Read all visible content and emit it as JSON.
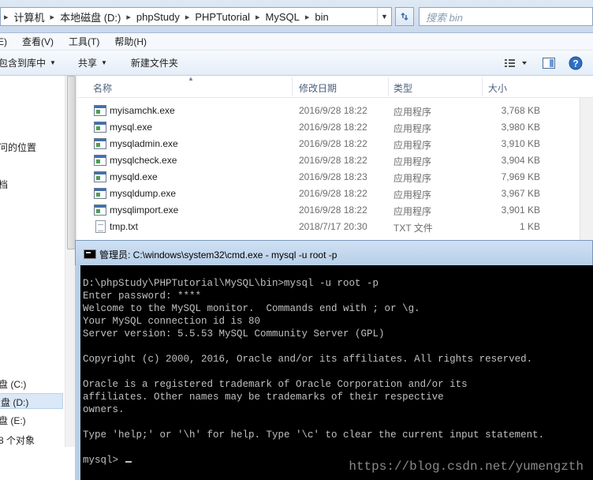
{
  "explorer": {
    "address": {
      "crumbs": [
        "计算机",
        "本地磁盘 (D:)",
        "phpStudy",
        "PHPTutorial",
        "MySQL",
        "bin"
      ],
      "dropdown_icon": "chevron-down-icon",
      "refresh_icon": "refresh-icon"
    },
    "search": {
      "placeholder": "搜索 bin"
    },
    "menu": [
      "E)",
      "查看(V)",
      "工具(T)",
      "帮助(H)"
    ],
    "toolbar": {
      "include_library": "包含到库中",
      "share": "共享",
      "new_folder": "新建文件夹"
    },
    "nav": {
      "recent": "问的位置",
      "docs": "档",
      "drive_c": "盘 (C:)",
      "drive_d": "盘 (D:)",
      "drive_e": "盘 (E:)",
      "count": "8 个对象"
    },
    "columns": {
      "name": "名称",
      "date": "修改日期",
      "type": "类型",
      "size": "大小"
    },
    "files": [
      {
        "name": "myisamchk.exe",
        "date": "2016/9/28 18:22",
        "type": "应用程序",
        "size": "3,768 KB",
        "icon": "exe"
      },
      {
        "name": "mysql.exe",
        "date": "2016/9/28 18:22",
        "type": "应用程序",
        "size": "3,980 KB",
        "icon": "exe"
      },
      {
        "name": "mysqladmin.exe",
        "date": "2016/9/28 18:22",
        "type": "应用程序",
        "size": "3,910 KB",
        "icon": "exe"
      },
      {
        "name": "mysqlcheck.exe",
        "date": "2016/9/28 18:22",
        "type": "应用程序",
        "size": "3,904 KB",
        "icon": "exe"
      },
      {
        "name": "mysqld.exe",
        "date": "2016/9/28 18:23",
        "type": "应用程序",
        "size": "7,969 KB",
        "icon": "exe"
      },
      {
        "name": "mysqldump.exe",
        "date": "2016/9/28 18:22",
        "type": "应用程序",
        "size": "3,967 KB",
        "icon": "exe"
      },
      {
        "name": "mysqlimport.exe",
        "date": "2016/9/28 18:22",
        "type": "应用程序",
        "size": "3,901 KB",
        "icon": "exe"
      },
      {
        "name": "tmp.txt",
        "date": "2018/7/17 20:30",
        "type": "TXT 文件",
        "size": "1 KB",
        "icon": "txt"
      }
    ]
  },
  "cmd": {
    "title": "管理员: C:\\windows\\system32\\cmd.exe - mysql  -u root -p",
    "lines": [
      "D:\\phpStudy\\PHPTutorial\\MySQL\\bin>mysql -u root -p",
      "Enter password: ****",
      "Welcome to the MySQL monitor.  Commands end with ; or \\g.",
      "Your MySQL connection id is 80",
      "Server version: 5.5.53 MySQL Community Server (GPL)",
      "",
      "Copyright (c) 2000, 2016, Oracle and/or its affiliates. All rights reserved.",
      "",
      "Oracle is a registered trademark of Oracle Corporation and/or its",
      "affiliates. Other names may be trademarks of their respective",
      "owners.",
      "",
      "Type 'help;' or '\\h' for help. Type '\\c' to clear the current input statement.",
      ""
    ],
    "prompt": "mysql> ",
    "watermark": "https://blog.csdn.net/yumengzth"
  }
}
